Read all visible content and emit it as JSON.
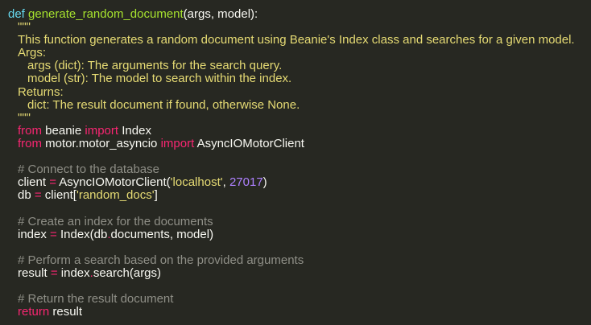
{
  "editor": {
    "colors": {
      "background": "#272822",
      "plain": "#f8f8f2",
      "keyword": "#f92672",
      "storage": "#66d9ef",
      "function": "#a6e22e",
      "docstring": "#e6db74",
      "string": "#e6db74",
      "number": "#ae81ff",
      "operator": "#f92672",
      "comment": "#8f8f87"
    },
    "lines": [
      {
        "indent": 0,
        "tokens": [
          {
            "t": "def",
            "k": "storage"
          },
          {
            "t": " ",
            "k": "plain"
          },
          {
            "t": "generate_random_document",
            "k": "function"
          },
          {
            "t": "(args, model):",
            "k": "plain"
          }
        ]
      },
      {
        "indent": 1,
        "tokens": [
          {
            "t": "\"\"\"",
            "k": "docstring"
          }
        ]
      },
      {
        "indent": 1,
        "tokens": [
          {
            "t": "This function generates a random document using Beanie's Index class and searches for a given model.",
            "k": "docstring"
          }
        ]
      },
      {
        "indent": 1,
        "tokens": [
          {
            "t": "Args:",
            "k": "docstring"
          }
        ]
      },
      {
        "indent": 2,
        "tokens": [
          {
            "t": "args (dict): The arguments for the search query.",
            "k": "docstring"
          }
        ]
      },
      {
        "indent": 2,
        "tokens": [
          {
            "t": "model (str): The model to search within the index.",
            "k": "docstring"
          }
        ]
      },
      {
        "indent": 1,
        "tokens": [
          {
            "t": "Returns:",
            "k": "docstring"
          }
        ]
      },
      {
        "indent": 2,
        "tokens": [
          {
            "t": "dict: The result document if found, otherwise None.",
            "k": "docstring"
          }
        ]
      },
      {
        "indent": 1,
        "tokens": [
          {
            "t": "\"\"\"",
            "k": "docstring"
          }
        ]
      },
      {
        "indent": 1,
        "tokens": [
          {
            "t": "from",
            "k": "keyword"
          },
          {
            "t": " beanie ",
            "k": "plain"
          },
          {
            "t": "import",
            "k": "keyword"
          },
          {
            "t": " Index",
            "k": "plain"
          }
        ]
      },
      {
        "indent": 1,
        "tokens": [
          {
            "t": "from",
            "k": "keyword"
          },
          {
            "t": " motor.motor_asyncio ",
            "k": "plain"
          },
          {
            "t": "import",
            "k": "keyword"
          },
          {
            "t": " AsyncIOMotorClient",
            "k": "plain"
          }
        ]
      },
      {
        "indent": 0,
        "tokens": []
      },
      {
        "indent": 1,
        "tokens": [
          {
            "t": "# Connect to the database",
            "k": "comment"
          }
        ]
      },
      {
        "indent": 1,
        "tokens": [
          {
            "t": "client ",
            "k": "plain"
          },
          {
            "t": "=",
            "k": "operator"
          },
          {
            "t": " AsyncIOMotorClient(",
            "k": "plain"
          },
          {
            "t": "'localhost'",
            "k": "string"
          },
          {
            "t": ", ",
            "k": "plain"
          },
          {
            "t": "27017",
            "k": "number"
          },
          {
            "t": ")",
            "k": "plain"
          }
        ]
      },
      {
        "indent": 1,
        "tokens": [
          {
            "t": "db ",
            "k": "plain"
          },
          {
            "t": "=",
            "k": "operator"
          },
          {
            "t": " client[",
            "k": "plain"
          },
          {
            "t": "'random_docs'",
            "k": "string"
          },
          {
            "t": "]",
            "k": "plain"
          }
        ]
      },
      {
        "indent": 0,
        "tokens": []
      },
      {
        "indent": 1,
        "tokens": [
          {
            "t": "# Create an index for the documents",
            "k": "comment"
          }
        ]
      },
      {
        "indent": 1,
        "tokens": [
          {
            "t": "index ",
            "k": "plain"
          },
          {
            "t": "=",
            "k": "operator"
          },
          {
            "t": " Index(db",
            "k": "plain"
          },
          {
            "t": ".",
            "k": "operator"
          },
          {
            "t": "documents, model)",
            "k": "plain"
          }
        ]
      },
      {
        "indent": 0,
        "tokens": []
      },
      {
        "indent": 1,
        "tokens": [
          {
            "t": "# Perform a search based on the provided arguments",
            "k": "comment"
          }
        ]
      },
      {
        "indent": 1,
        "tokens": [
          {
            "t": "result ",
            "k": "plain"
          },
          {
            "t": "=",
            "k": "operator"
          },
          {
            "t": " index",
            "k": "plain"
          },
          {
            "t": ".",
            "k": "operator"
          },
          {
            "t": "search(args)",
            "k": "plain"
          }
        ]
      },
      {
        "indent": 0,
        "tokens": []
      },
      {
        "indent": 1,
        "tokens": [
          {
            "t": "# Return the result document",
            "k": "comment"
          }
        ]
      },
      {
        "indent": 1,
        "tokens": [
          {
            "t": "return",
            "k": "keyword"
          },
          {
            "t": " result",
            "k": "plain"
          }
        ]
      }
    ]
  }
}
